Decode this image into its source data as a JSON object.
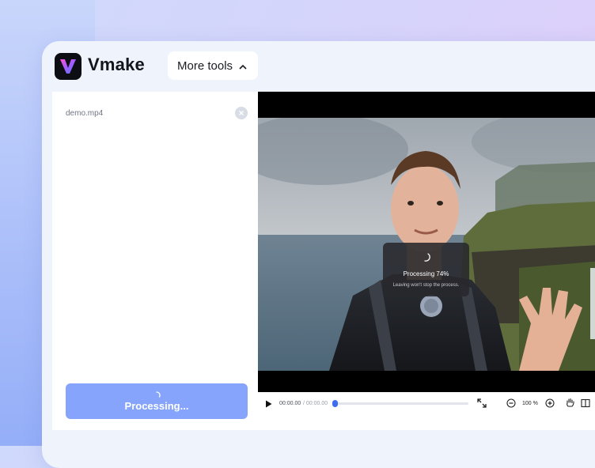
{
  "app": {
    "brand": "Vmake",
    "more_tools_label": "More tools"
  },
  "sidebar": {
    "file_name": "demo.mp4",
    "process_button_label": "Processing..."
  },
  "overlay": {
    "status": "Processing 74%",
    "progress_percent": 74,
    "note": "Leaving won't stop the process."
  },
  "player": {
    "current_time": "00:00.00",
    "duration": "/ 00:00.00",
    "zoom": "100 %"
  },
  "colors": {
    "accent": "#3d6df0",
    "button": "#86a4fb",
    "overlay": "#28282c"
  }
}
